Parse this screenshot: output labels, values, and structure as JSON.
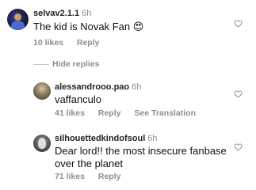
{
  "comments": [
    {
      "username": "selvav2.1.1",
      "time": "6h",
      "text": "The kid is Novak Fan 😍",
      "likes": "10 likes",
      "reply": "Reply"
    },
    {
      "username": "alessandrooo.pao",
      "time": "6h",
      "text": "vaffanculo",
      "likes": "41 likes",
      "reply": "Reply",
      "translate": "See Translation"
    },
    {
      "username": "silhouettedkindofsoul",
      "time": "6h",
      "text_line1": "Dear lord!! the most insecure fanbase",
      "text_line2": "over the planet",
      "likes": "71 likes",
      "reply": "Reply"
    }
  ],
  "hide_replies": "Hide replies",
  "icons": {
    "like": "heart-outline-icon"
  }
}
